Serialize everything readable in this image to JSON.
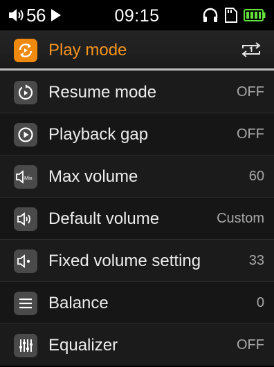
{
  "status_bar": {
    "volume": "56",
    "time": "09:15",
    "icons": [
      "speaker-icon",
      "play-icon",
      "headphones-icon",
      "sd-card-icon",
      "battery-icon"
    ]
  },
  "menu": {
    "items": [
      {
        "label": "Play mode",
        "value": "",
        "icon": "play-mode-icon",
        "value_icon": "repeat-one-icon",
        "selected": true
      },
      {
        "label": "Resume mode",
        "value": "OFF",
        "icon": "resume-icon"
      },
      {
        "label": "Playback gap",
        "value": "OFF",
        "icon": "playback-gap-icon"
      },
      {
        "label": "Max volume",
        "value": "60",
        "icon": "max-volume-icon"
      },
      {
        "label": "Default volume",
        "value": "Custom",
        "icon": "default-volume-icon"
      },
      {
        "label": "Fixed volume setting",
        "value": "33",
        "icon": "fixed-volume-icon"
      },
      {
        "label": "Balance",
        "value": "0",
        "icon": "balance-icon"
      },
      {
        "label": "Equalizer",
        "value": "OFF",
        "icon": "equalizer-icon"
      }
    ]
  },
  "colors": {
    "accent": "#f7931d",
    "battery": "#63e03a",
    "row_bg": "#1b1b1b",
    "icon_bg": "#4a4a4a"
  }
}
